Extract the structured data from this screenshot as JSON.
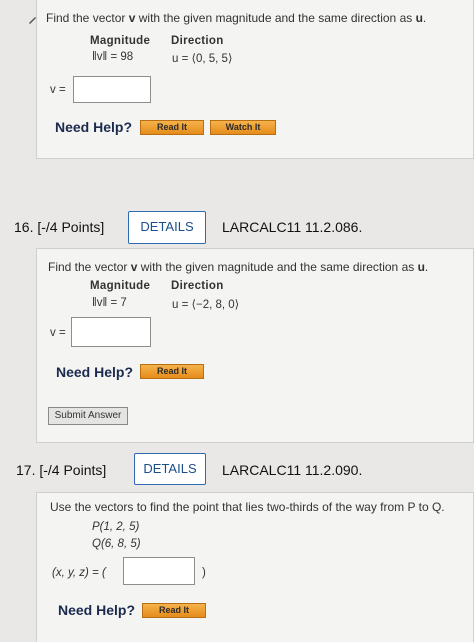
{
  "q15": {
    "prompt_start": "Find the vector ",
    "prompt_v": "v",
    "prompt_end": " with the given magnitude and the same direction as ",
    "prompt_u": "u",
    "prompt_dot": ".",
    "magnitude_header": "Magnitude",
    "direction_header": "Direction",
    "magnitude_value": "‖v‖ = 98",
    "direction_value": "u = ⟨0, 5, 5⟩",
    "answer_label": "v =",
    "answer_value": "",
    "need_help": "Need Help?",
    "read_it": "Read It",
    "watch_it": "Watch It"
  },
  "q16": {
    "number": "16.  [-/4 Points]",
    "details": "DETAILS",
    "code": "LARCALC11 11.2.086.",
    "prompt_start": "Find the vector ",
    "prompt_v": "v",
    "prompt_end": " with the given magnitude and the same direction as ",
    "prompt_u": "u",
    "prompt_dot": ".",
    "magnitude_header": "Magnitude",
    "direction_header": "Direction",
    "magnitude_value": "‖v‖ = 7",
    "direction_value": "u = ⟨−2, 8, 0⟩",
    "answer_label": "v =",
    "answer_value": "",
    "need_help": "Need Help?",
    "read_it": "Read It",
    "submit": "Submit Answer"
  },
  "q17": {
    "number": "17.  [-/4 Points]",
    "details": "DETAILS",
    "code": "LARCALC11 11.2.090.",
    "prompt": "Use the vectors to find the point that lies two-thirds of the way from P to Q.",
    "point_p": "P(1, 2, 5)",
    "point_q": "Q(6, 8, 5)",
    "answer_label": "(x, y, z) = (",
    "answer_close": ")",
    "answer_value": "",
    "need_help": "Need Help?",
    "read_it": "Read It"
  }
}
